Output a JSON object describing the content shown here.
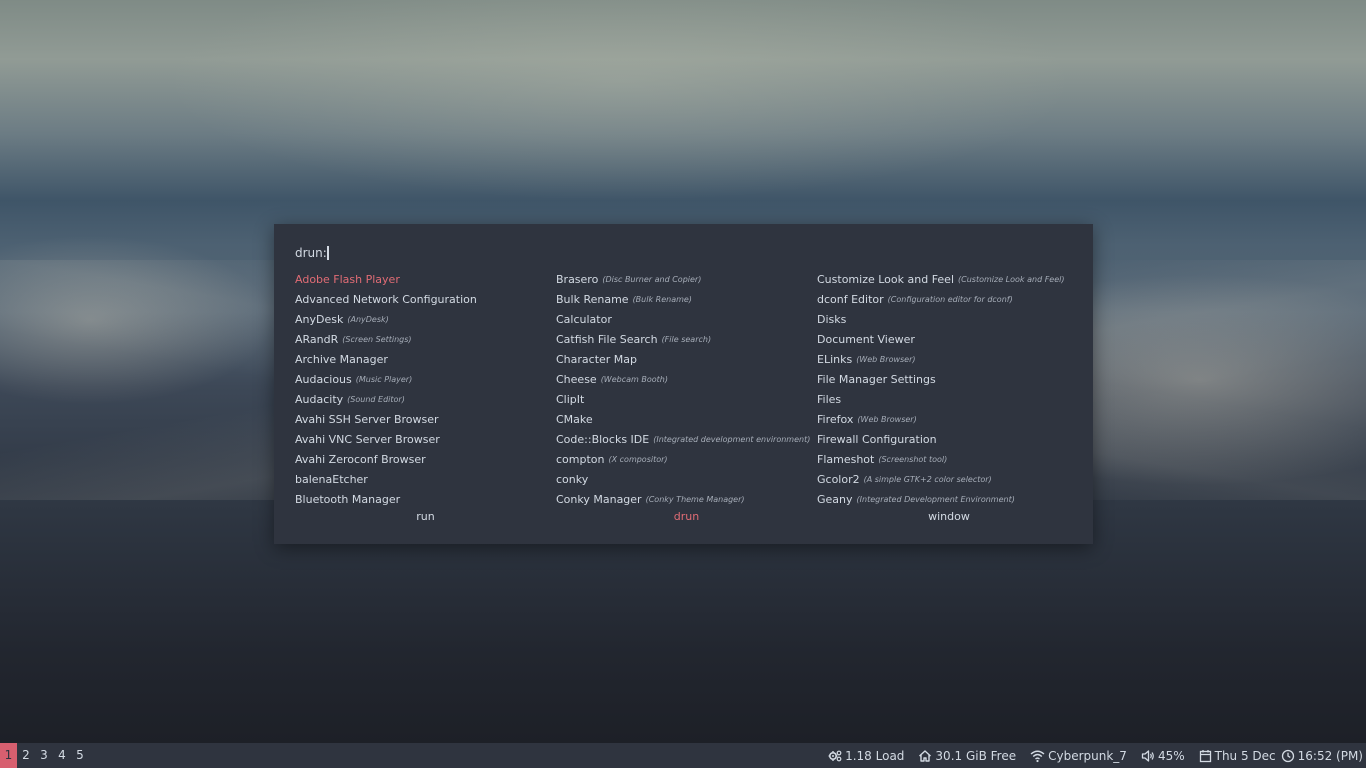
{
  "launcher": {
    "prompt_label": "drun:",
    "input_value": "",
    "entries": [
      {
        "name": "Adobe Flash Player",
        "desc": "",
        "selected": true
      },
      {
        "name": "Advanced Network Configuration",
        "desc": ""
      },
      {
        "name": "AnyDesk",
        "desc": "(AnyDesk)"
      },
      {
        "name": "ARandR",
        "desc": "(Screen Settings)"
      },
      {
        "name": "Archive Manager",
        "desc": ""
      },
      {
        "name": "Audacious",
        "desc": "(Music Player)"
      },
      {
        "name": "Audacity",
        "desc": "(Sound Editor)"
      },
      {
        "name": "Avahi SSH Server Browser",
        "desc": ""
      },
      {
        "name": "Avahi VNC Server Browser",
        "desc": ""
      },
      {
        "name": "Avahi Zeroconf Browser",
        "desc": ""
      },
      {
        "name": "balenaEtcher",
        "desc": ""
      },
      {
        "name": "Bluetooth Manager",
        "desc": ""
      },
      {
        "name": "Brasero",
        "desc": "(Disc Burner and Copier)"
      },
      {
        "name": "Bulk Rename",
        "desc": "(Bulk Rename)"
      },
      {
        "name": "Calculator",
        "desc": ""
      },
      {
        "name": "Catfish File Search",
        "desc": "(File search)"
      },
      {
        "name": "Character Map",
        "desc": ""
      },
      {
        "name": "Cheese",
        "desc": "(Webcam Booth)"
      },
      {
        "name": "ClipIt",
        "desc": ""
      },
      {
        "name": "CMake",
        "desc": ""
      },
      {
        "name": "Code::Blocks IDE",
        "desc": "(Integrated development environment)"
      },
      {
        "name": "compton",
        "desc": "(X compositor)"
      },
      {
        "name": "conky",
        "desc": ""
      },
      {
        "name": "Conky Manager",
        "desc": "(Conky Theme Manager)"
      },
      {
        "name": "Customize Look and Feel",
        "desc": "(Customize Look and Feel)"
      },
      {
        "name": "dconf Editor",
        "desc": "(Configuration editor for dconf)"
      },
      {
        "name": "Disks",
        "desc": ""
      },
      {
        "name": "Document Viewer",
        "desc": ""
      },
      {
        "name": "ELinks",
        "desc": "(Web Browser)"
      },
      {
        "name": "File Manager Settings",
        "desc": ""
      },
      {
        "name": "Files",
        "desc": ""
      },
      {
        "name": "Firefox",
        "desc": "(Web Browser)"
      },
      {
        "name": "Firewall Configuration",
        "desc": ""
      },
      {
        "name": "Flameshot",
        "desc": "(Screenshot tool)"
      },
      {
        "name": "Gcolor2",
        "desc": "(A simple GTK+2 color selector)"
      },
      {
        "name": "Geany",
        "desc": "(Integrated Development Environment)"
      }
    ],
    "modes": [
      {
        "label": "run",
        "active": false
      },
      {
        "label": "drun",
        "active": true
      },
      {
        "label": "window",
        "active": false
      }
    ]
  },
  "bar": {
    "workspaces": [
      {
        "label": "1",
        "active": true
      },
      {
        "label": "2",
        "active": false
      },
      {
        "label": "3",
        "active": false
      },
      {
        "label": "4",
        "active": false
      },
      {
        "label": "5",
        "active": false
      }
    ],
    "load": {
      "icon": "cpu-gear-icon",
      "text": "1.18 Load"
    },
    "disk": {
      "icon": "home-icon",
      "text": "30.1 GiB Free"
    },
    "wifi": {
      "icon": "wifi-icon",
      "text": "Cyberpunk_7"
    },
    "volume": {
      "icon": "speaker-icon",
      "text": "45%"
    },
    "date": {
      "icon": "calendar-icon",
      "text": "Thu 5 Dec"
    },
    "time": {
      "icon": "clock-icon",
      "text": "16:52 (PM)"
    }
  },
  "colors": {
    "panel_bg": "#2f343f",
    "text": "#d3dae3",
    "accent": "#e06c75",
    "workspace_active": "#d75f6f"
  }
}
